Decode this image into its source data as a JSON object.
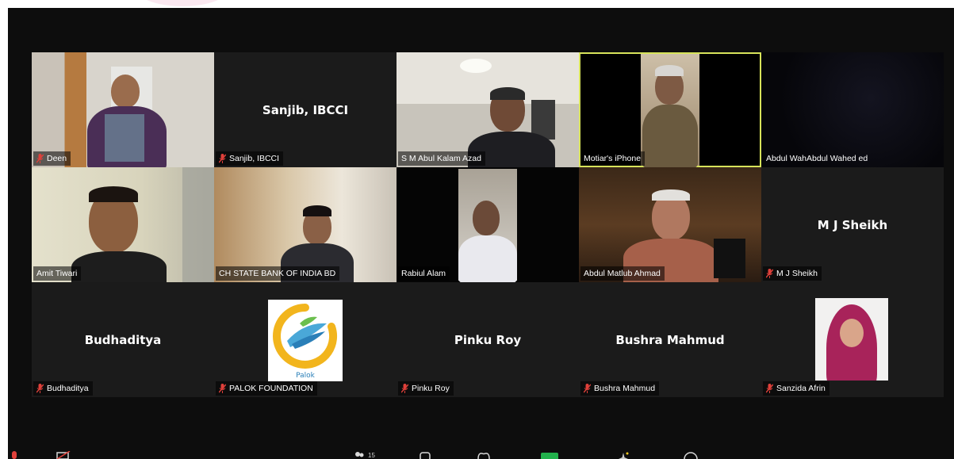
{
  "colors": {
    "window_bg": "#0d0d0d",
    "tile_bg": "#1b1b1b",
    "active_speaker_border": "#d7e35a",
    "muted_mic": "#e0403a"
  },
  "participants": [
    {
      "name": "Deen",
      "muted": true,
      "video": true
    },
    {
      "name": "Sanjib, IBCCI",
      "muted": true,
      "video": false
    },
    {
      "name": "S M Abul Kalam Azad",
      "muted": false,
      "video": true
    },
    {
      "name": "Motiar's iPhone",
      "muted": false,
      "video": true,
      "active": true
    },
    {
      "name": "Abdul WahAbdul Wahed ed",
      "muted": false,
      "video": true
    },
    {
      "name": "Amit Tiwari",
      "muted": false,
      "video": true
    },
    {
      "name": "CH STATE BANK OF INDIA BD",
      "muted": false,
      "video": true
    },
    {
      "name": "Rabiul Alam",
      "muted": false,
      "video": true
    },
    {
      "name": "Abdul Matlub Ahmad",
      "muted": false,
      "video": true
    },
    {
      "name": "M J Sheikh",
      "muted": true,
      "video": false
    },
    {
      "name": "Budhaditya",
      "muted": true,
      "video": false
    },
    {
      "name": "PALOK FOUNDATION",
      "muted": true,
      "video": false,
      "avatar": "palok-logo"
    },
    {
      "name": "Pinku Roy",
      "muted": true,
      "video": false
    },
    {
      "name": "Bushra Mahmud",
      "muted": true,
      "video": false
    },
    {
      "name": "Sanzida Afrin",
      "muted": true,
      "video": false,
      "avatar": "profile-photo"
    }
  ],
  "toolbar": {
    "participants_count": "15"
  }
}
